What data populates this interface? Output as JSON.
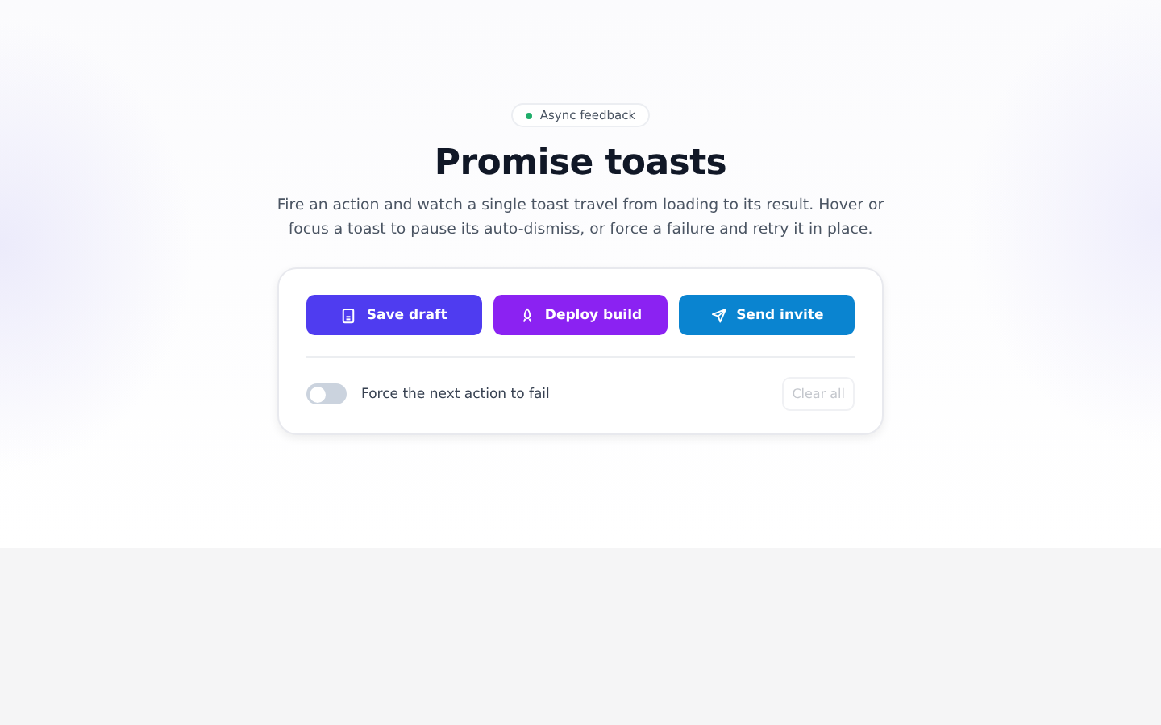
{
  "badge": {
    "label": "Async feedback"
  },
  "title": "Promise toasts",
  "description": "Fire an action and watch a single toast travel from loading to its result. Hover or focus a toast to pause its auto-dismiss, or force a failure and retry it in place.",
  "actions": [
    {
      "label": "Save draft",
      "color": "#4f3cf0"
    },
    {
      "label": "Deploy build",
      "color": "#8b22f2"
    },
    {
      "label": "Send invite",
      "color": "#0a84d0"
    }
  ],
  "force_failure": {
    "label": "Force the next action to fail",
    "on": false
  },
  "clear_all": {
    "label": "Clear all",
    "disabled": true
  }
}
